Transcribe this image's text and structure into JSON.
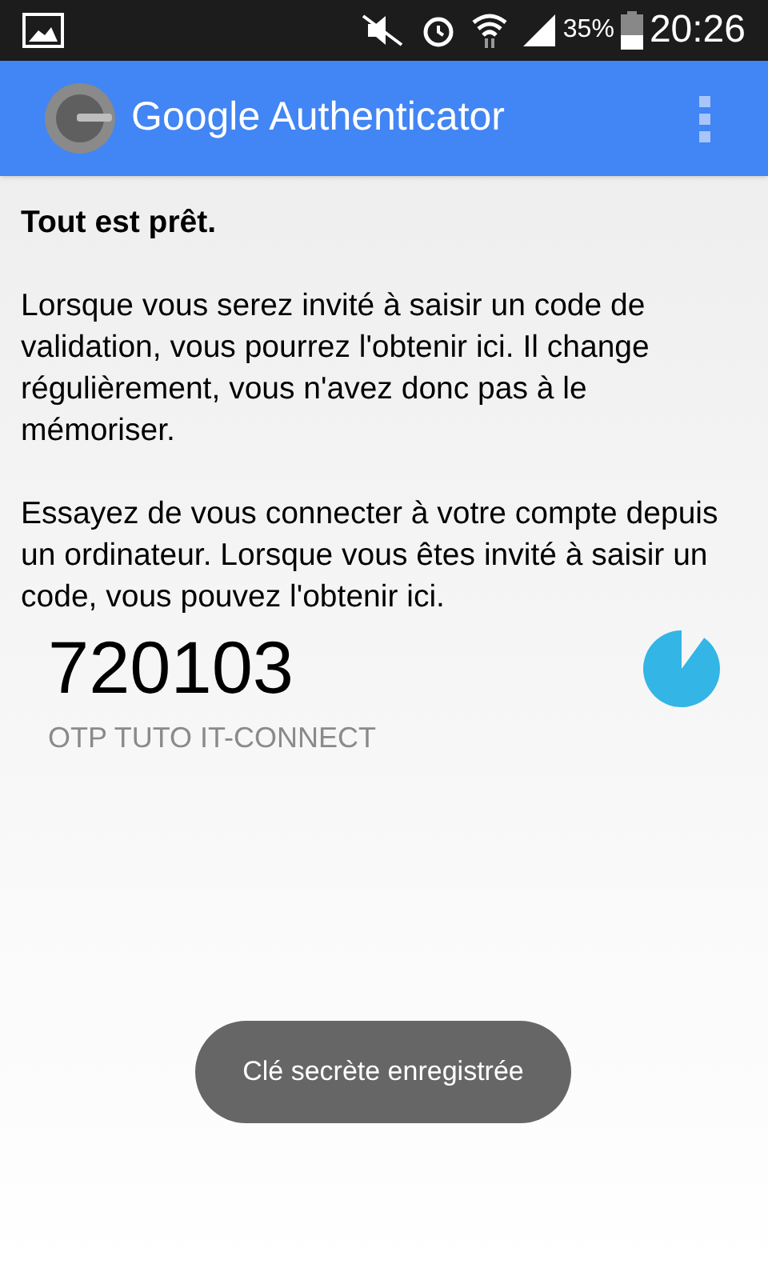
{
  "status_bar": {
    "battery": "35%",
    "time": "20:26"
  },
  "app_bar": {
    "title": "Google Authenticator"
  },
  "heading": "Tout est prêt.",
  "paragraphs": [
    "Lorsque vous serez invité à saisir un code de validation, vous pourrez l'obtenir ici. Il change régulièrement, vous n'avez donc pas à le mémoriser.",
    "Essayez de vous connecter à votre compte depuis un ordinateur. Lorsque vous êtes invité à saisir un code, vous pouvez l'obtenir ici."
  ],
  "accounts": [
    {
      "code": "720103",
      "name": "OTP TUTO IT-CONNECT"
    }
  ],
  "toast": "Clé secrète enregistrée"
}
